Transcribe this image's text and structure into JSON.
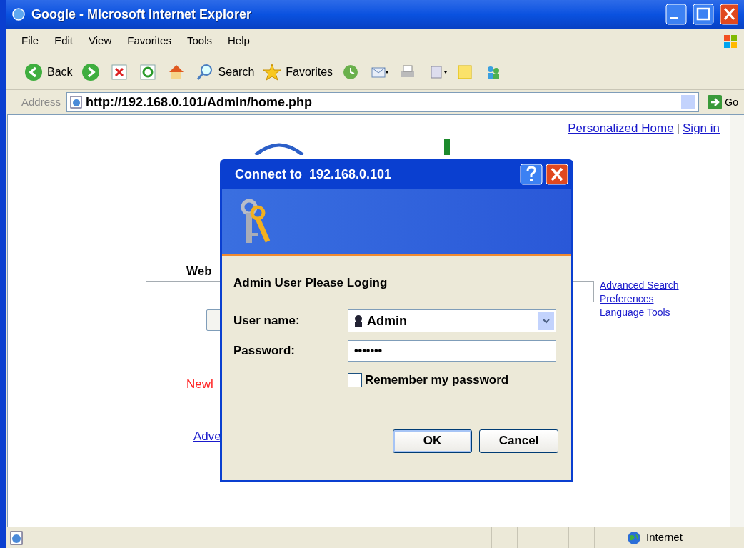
{
  "window": {
    "title": "Google - Microsoft Internet Explorer"
  },
  "menu": [
    "File",
    "Edit",
    "View",
    "Favorites",
    "Tools",
    "Help"
  ],
  "toolbar": [
    {
      "kind": "back",
      "label": "Back"
    },
    {
      "kind": "forward"
    },
    {
      "kind": "stop"
    },
    {
      "kind": "refresh"
    },
    {
      "kind": "home"
    },
    {
      "kind": "search",
      "label": "Search"
    },
    {
      "kind": "favorites",
      "label": "Favorites"
    },
    {
      "kind": "history"
    },
    {
      "kind": "mail"
    },
    {
      "kind": "print"
    },
    {
      "kind": "edit"
    },
    {
      "kind": "notes"
    },
    {
      "kind": "messenger"
    }
  ],
  "address_bar": {
    "label": "Address",
    "url": "http://192.168.0.101/Admin/home.php",
    "go": "Go"
  },
  "page": {
    "top_links": [
      "Personalized Home",
      "|",
      "Sign in"
    ],
    "web_label": "Web",
    "side_links": [
      "Advanced Search",
      "Preferences",
      "Language Tools"
    ],
    "news_text": "Newl",
    "bottom_link": "Adve"
  },
  "dialog": {
    "title": "Connect to  192.168.0.101",
    "prompt": "Admin User Please Loging",
    "user_label": "User name:",
    "user_value": "Admin",
    "password_label": "Password:",
    "password_value": "•••••••",
    "remember": {
      "label": "Remember my password",
      "checked": false
    },
    "buttons": [
      {
        "label": "OK",
        "selected": true
      },
      {
        "label": "Cancel",
        "selected": false
      }
    ]
  },
  "status_bar": {
    "zone": "Internet"
  }
}
